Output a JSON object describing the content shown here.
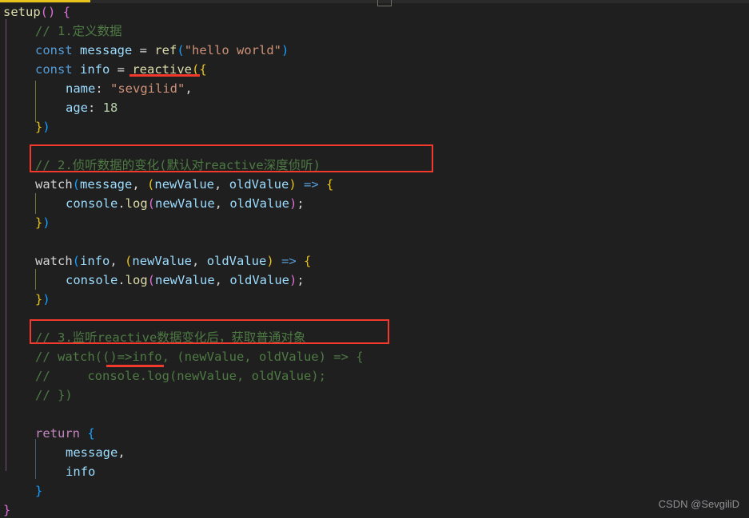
{
  "editor": {
    "background_color": "#1f1f1f",
    "tab_indicator_color": "#e8c21c",
    "annotation_color": "#f2392c",
    "watermark": "CSDN @SevgiliD"
  },
  "code_lines": [
    {
      "n": 1,
      "indent": 0,
      "text": "setup() {"
    },
    {
      "n": 2,
      "indent": 1,
      "text": "// 1.定义数据"
    },
    {
      "n": 3,
      "indent": 1,
      "text": "const message = ref(\"hello world\")"
    },
    {
      "n": 4,
      "indent": 1,
      "text": "const info = reactive({"
    },
    {
      "n": 5,
      "indent": 2,
      "text": "name: \"sevgilid\","
    },
    {
      "n": 6,
      "indent": 2,
      "text": "age: 18"
    },
    {
      "n": 7,
      "indent": 1,
      "text": "})"
    },
    {
      "n": 8,
      "indent": 0,
      "text": ""
    },
    {
      "n": 9,
      "indent": 1,
      "text": "// 2.侦听数据的变化(默认对reactive深度侦听)"
    },
    {
      "n": 10,
      "indent": 1,
      "text": "watch(message, (newValue, oldValue) => {"
    },
    {
      "n": 11,
      "indent": 2,
      "text": "console.log(newValue, oldValue);"
    },
    {
      "n": 12,
      "indent": 1,
      "text": "})"
    },
    {
      "n": 13,
      "indent": 0,
      "text": ""
    },
    {
      "n": 14,
      "indent": 1,
      "text": "watch(info, (newValue, oldValue) => {"
    },
    {
      "n": 15,
      "indent": 2,
      "text": "console.log(newValue, oldValue);"
    },
    {
      "n": 16,
      "indent": 1,
      "text": "})"
    },
    {
      "n": 17,
      "indent": 0,
      "text": ""
    },
    {
      "n": 18,
      "indent": 1,
      "text": "// 3.监听reactive数据变化后，获取普通对象"
    },
    {
      "n": 19,
      "indent": 1,
      "text": "// watch(()=>info, (newValue, oldValue) => {"
    },
    {
      "n": 20,
      "indent": 1,
      "text": "//     console.log(newValue, oldValue);"
    },
    {
      "n": 21,
      "indent": 1,
      "text": "// })"
    },
    {
      "n": 22,
      "indent": 0,
      "text": ""
    },
    {
      "n": 23,
      "indent": 1,
      "text": "return {"
    },
    {
      "n": 24,
      "indent": 2,
      "text": "message,"
    },
    {
      "n": 25,
      "indent": 2,
      "text": "info"
    },
    {
      "n": 26,
      "indent": 1,
      "text": "}"
    },
    {
      "n": 27,
      "indent": 0,
      "text": "}"
    }
  ],
  "tokens": {
    "l1": {
      "fn": "setup",
      "paren": "()",
      "space": " ",
      "brace": "{"
    },
    "l2": {
      "comment": "// 1.定义数据"
    },
    "l3": {
      "kw": "const",
      "name": "message",
      "eq": " = ",
      "fn": "ref",
      "open": "(",
      "str": "\"hello world\"",
      "close": ")"
    },
    "l4": {
      "kw": "const",
      "name": "info",
      "eq": " = ",
      "fn": "reactive",
      "open": "(",
      "brace": "{"
    },
    "l5": {
      "key": "name",
      "colon": ": ",
      "str": "\"sevgilid\"",
      "comma": ","
    },
    "l6": {
      "key": "age",
      "colon": ": ",
      "num": "18"
    },
    "l7": {
      "brace": "}",
      "paren": ")"
    },
    "l9": {
      "comment": "// 2.侦听数据的变化(默认对reactive深度侦听)"
    },
    "l10": {
      "fn": "watch",
      "open": "(",
      "arg": "message",
      "comma": ", ",
      "open2": "(",
      "p1": "newValue",
      "comma2": ", ",
      "p2": "oldValue",
      "close2": ")",
      "arrow": " => ",
      "brace": "{"
    },
    "l11": {
      "obj": "console",
      "dot": ".",
      "method": "log",
      "open": "(",
      "a1": "newValue",
      "comma": ", ",
      "a2": "oldValue",
      "close": ")",
      "semi": ";"
    },
    "l12": {
      "brace": "}",
      "paren": ")"
    },
    "l14": {
      "fn": "watch",
      "open": "(",
      "arg": "info",
      "comma": ", ",
      "open2": "(",
      "p1": "newValue",
      "comma2": ", ",
      "p2": "oldValue",
      "close2": ")",
      "arrow": " => ",
      "brace": "{"
    },
    "l15": {
      "obj": "console",
      "dot": ".",
      "method": "log",
      "open": "(",
      "a1": "newValue",
      "comma": ", ",
      "a2": "oldValue",
      "close": ")",
      "semi": ";"
    },
    "l16": {
      "brace": "}",
      "paren": ")"
    },
    "l18": {
      "comment": "// 3.监听reactive数据变化后，获取普通对象"
    },
    "l19": {
      "comment": "// watch(()=>info, (newValue, oldValue) => {"
    },
    "l20": {
      "comment": "//     console.log(newValue, oldValue);"
    },
    "l21": {
      "comment": "// })"
    },
    "l23": {
      "kw": "return",
      "space": " ",
      "brace": "{"
    },
    "l24": {
      "name": "message",
      "comma": ","
    },
    "l25": {
      "name": "info"
    },
    "l26": {
      "brace": "}"
    },
    "l27": {
      "brace": "}"
    }
  },
  "annotations": [
    {
      "id": "underline-reactive",
      "type": "underline",
      "target": "reactive"
    },
    {
      "id": "box-comment-2",
      "type": "box",
      "target": "// 2.侦听数据的变化(默认对reactive深度侦听)"
    },
    {
      "id": "box-comment-3",
      "type": "box",
      "target": "// 3.监听reactive数据变化后，获取普通对象"
    },
    {
      "id": "underline-info-comment",
      "type": "underline",
      "target": "info"
    }
  ]
}
